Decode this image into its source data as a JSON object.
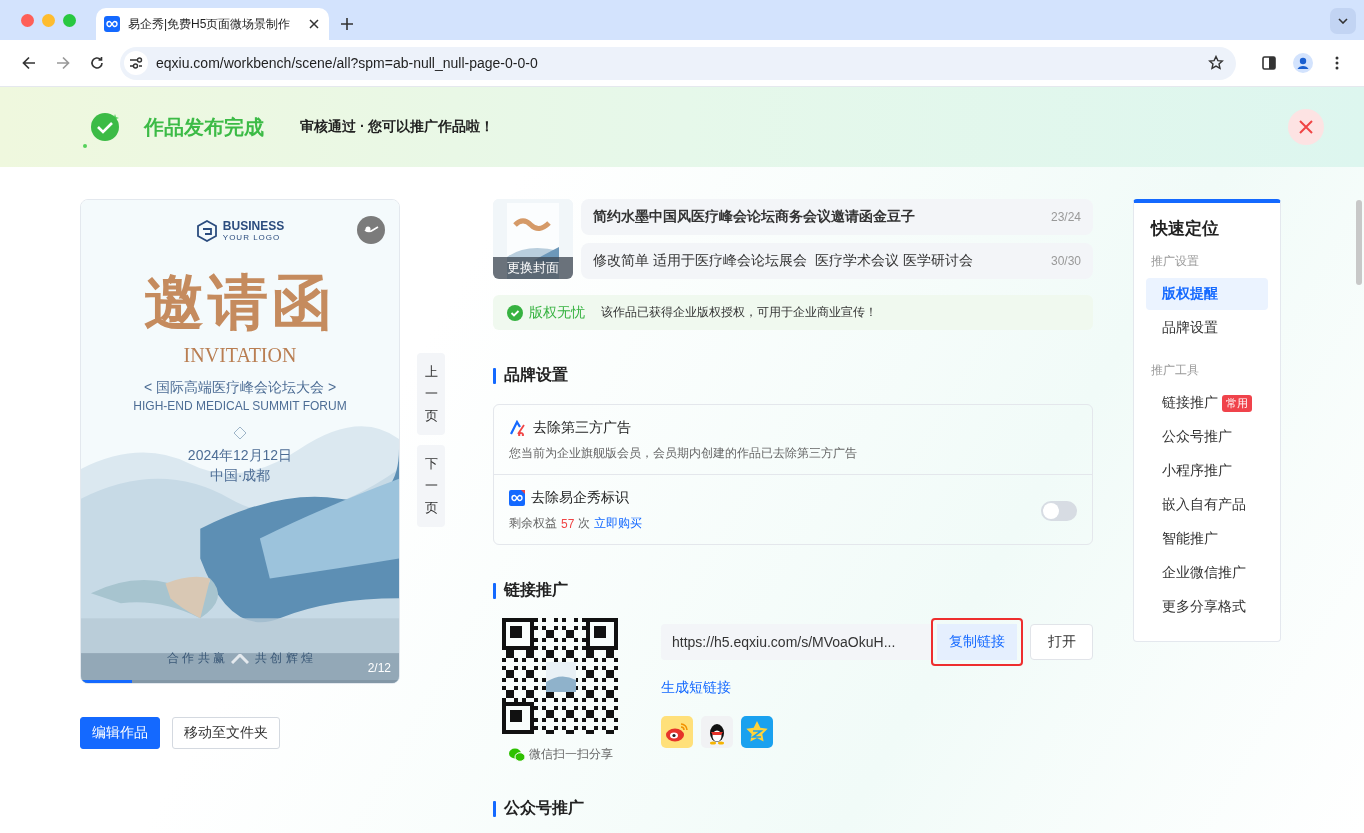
{
  "browser": {
    "tab_title": "易企秀|免费H5页面微场景制作",
    "url": "eqxiu.com/workbench/scene/all?spm=ab-null_null-page-0-0-0"
  },
  "banner": {
    "title": "作品发布完成",
    "subtitle": "审核通过 · 您可以推广作品啦！"
  },
  "poster": {
    "logo_name": "BUSINESS",
    "logo_tagline": "YOUR LOGO",
    "headline": "邀请函",
    "headline_en": "INVITATION",
    "event_name": "< 国际高端医疗峰会论坛大会 >",
    "event_name_en": "HIGH-END MEDICAL SUMMIT FORUM",
    "date": "2024年12月12日",
    "place": "中国·成都",
    "motto_left": "合 作 共 赢",
    "motto_right": "共 创 辉 煌",
    "page_counter": "2/12",
    "level": 0.16
  },
  "page_nav": [
    {
      "label": "上一页"
    },
    {
      "label": "下一页"
    }
  ],
  "actions": [
    {
      "label": "编辑作品",
      "kind": "primary"
    },
    {
      "label": "移动至文件夹",
      "kind": "default"
    }
  ],
  "work": {
    "cover_label": "更换封面",
    "title": "简约水墨中国风医疗峰会论坛商务会议邀请函金豆子",
    "title_count": "23/24",
    "description": "修改简单 适用于医疗峰会论坛展会  医疗学术会议 医学研讨会",
    "description_count": "30/30"
  },
  "copyright": {
    "label": "版权无忧",
    "text": "该作品已获得企业版权授权，可用于企业商业宣传！"
  },
  "brand_settings": {
    "title": "品牌设置",
    "items": [
      {
        "kind": "info",
        "title": "去除第三方广告",
        "description": "您当前为企业旗舰版会员，会员期内创建的作品已去除第三方广告"
      },
      {
        "kind": "toggle",
        "title": "去除易企秀标识",
        "quota_label": "剩余权益",
        "quota_count": "57",
        "quota_unit": "次",
        "buy_link": "立即购买",
        "on": false
      }
    ]
  },
  "link_promotion": {
    "title": "链接推广",
    "qr_caption": "微信扫一扫分享",
    "url": "https://h5.eqxiu.com/s/MVoaOkuH...",
    "copy_button": "复制链接",
    "copy_highlighted": true,
    "open_button": "打开",
    "short_link": "生成短链接"
  },
  "next_section": {
    "title": "公众号推广"
  },
  "quick_nav": {
    "title": "快速定位",
    "groups": [
      {
        "label": "推广设置",
        "items": [
          {
            "label": "版权提醒",
            "selected": true
          },
          {
            "label": "品牌设置",
            "selected": false
          }
        ]
      },
      {
        "label": "推广工具",
        "items": [
          {
            "label": "链接推广",
            "selected": false,
            "badge": "常用"
          },
          {
            "label": "公众号推广",
            "selected": false
          },
          {
            "label": "小程序推广",
            "selected": false
          },
          {
            "label": "嵌入自有产品",
            "selected": false
          },
          {
            "label": "智能推广",
            "selected": false
          },
          {
            "label": "企业微信推广",
            "selected": false
          },
          {
            "label": "更多分享格式",
            "selected": false
          }
        ]
      }
    ]
  }
}
